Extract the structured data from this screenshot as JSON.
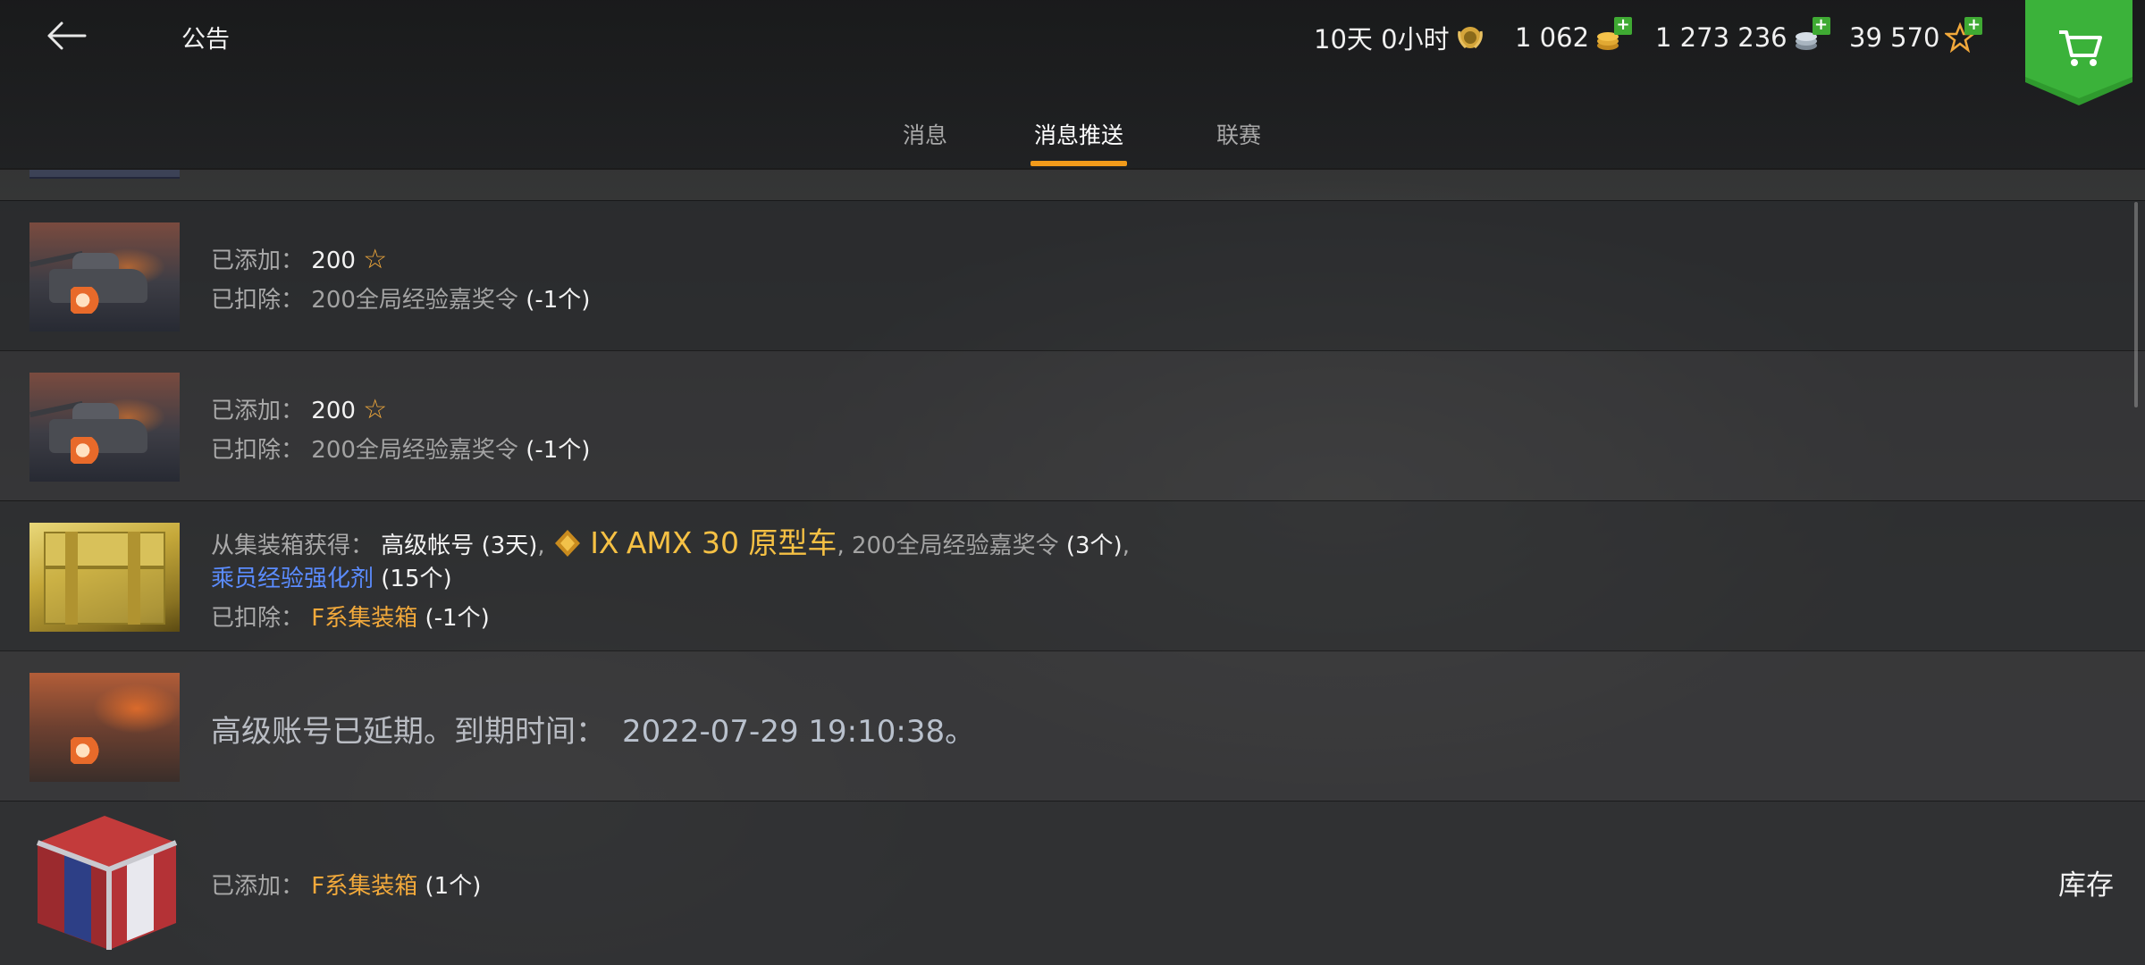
{
  "header": {
    "back_icon": "arrow-left-icon",
    "title": "公告",
    "premium_time": "10天 0小时",
    "gold": "1 062",
    "credits": "1 273 236",
    "free_xp": "39 570",
    "cart_icon": "shopping-cart-icon"
  },
  "tabs": [
    {
      "label": "消息",
      "active": false
    },
    {
      "label": "消息推送",
      "active": true
    },
    {
      "label": "联赛",
      "active": false
    }
  ],
  "messages": [
    {
      "added_label": "已添加：",
      "added_value": "200",
      "deducted_label": "已扣除：",
      "deducted_item": "200全局经验嘉奖令",
      "deducted_qty": "(-1个)"
    },
    {
      "added_label": "已添加：",
      "added_value": "200",
      "deducted_label": "已扣除：",
      "deducted_item": "200全局经验嘉奖令",
      "deducted_qty": "(-1个)"
    },
    {
      "source_label": "从集装箱获得：",
      "premium": "高级帐号",
      "premium_qty": "(3天)",
      "comma": ",",
      "tank_tier": "IX",
      "tank_name": "AMX 30 原型车",
      "item2": "200全局经验嘉奖令",
      "item2_qty": "(3个)",
      "item3": "乘员经验强化剂",
      "item3_qty": "(15个)",
      "deducted_label": "已扣除：",
      "deducted_item": "F系集装箱",
      "deducted_qty": "(-1个)"
    },
    {
      "text": "高级账号已延期。到期时间：",
      "date": "2022-07-29 19:10:38。"
    },
    {
      "added_label": "已添加：",
      "added_item": "F系集装箱",
      "added_qty": "(1个)"
    }
  ],
  "inventory_label": "库存",
  "colors": {
    "accent_orange": "#f19a1a",
    "gold_text": "#f2a93b",
    "link_blue": "#5b8cff",
    "cart_green": "#2f9a2e"
  }
}
